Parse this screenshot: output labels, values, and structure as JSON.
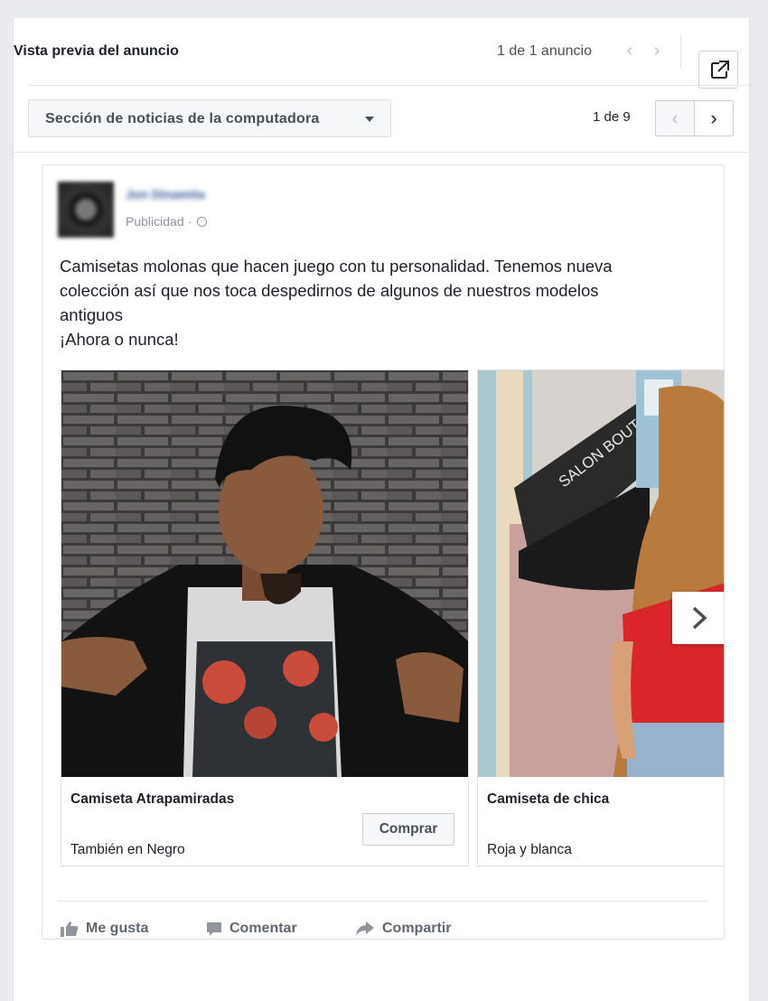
{
  "preview": {
    "title": "Vista previa del anuncio",
    "ad_count": "1 de 1 anuncio"
  },
  "placement": {
    "label": "Sección de noticias de la computadora",
    "page_count": "1 de 9"
  },
  "post": {
    "page_name": "Jon Dinamita",
    "sponsored": "Publicidad · ",
    "text_lines": [
      "Camisetas molonas que hacen juego con tu personalidad. Tenemos nueva",
      "colección así que nos toca despedirnos de algunos de nuestros modelos",
      "antiguos",
      "¡Ahora o nunca!"
    ],
    "cards": [
      {
        "title": "Camiseta Atrapamiradas",
        "description": "También en Negro",
        "cta": "Comprar"
      },
      {
        "title": "Camiseta de chica",
        "description": "Roja y blanca",
        "awning_text": "SALON BOUTI"
      }
    ],
    "actions": {
      "like": "Me gusta",
      "comment": "Comentar",
      "share": "Compartir"
    }
  },
  "icons": {
    "external": "open-in-new-icon",
    "globe": "globe-icon",
    "like": "thumbs-up-icon",
    "comment": "comment-icon",
    "share": "share-arrow-icon"
  },
  "colors": {
    "background": "#e9ebee",
    "link": "#365899",
    "muted": "#90949c",
    "border": "#dddfe2"
  }
}
